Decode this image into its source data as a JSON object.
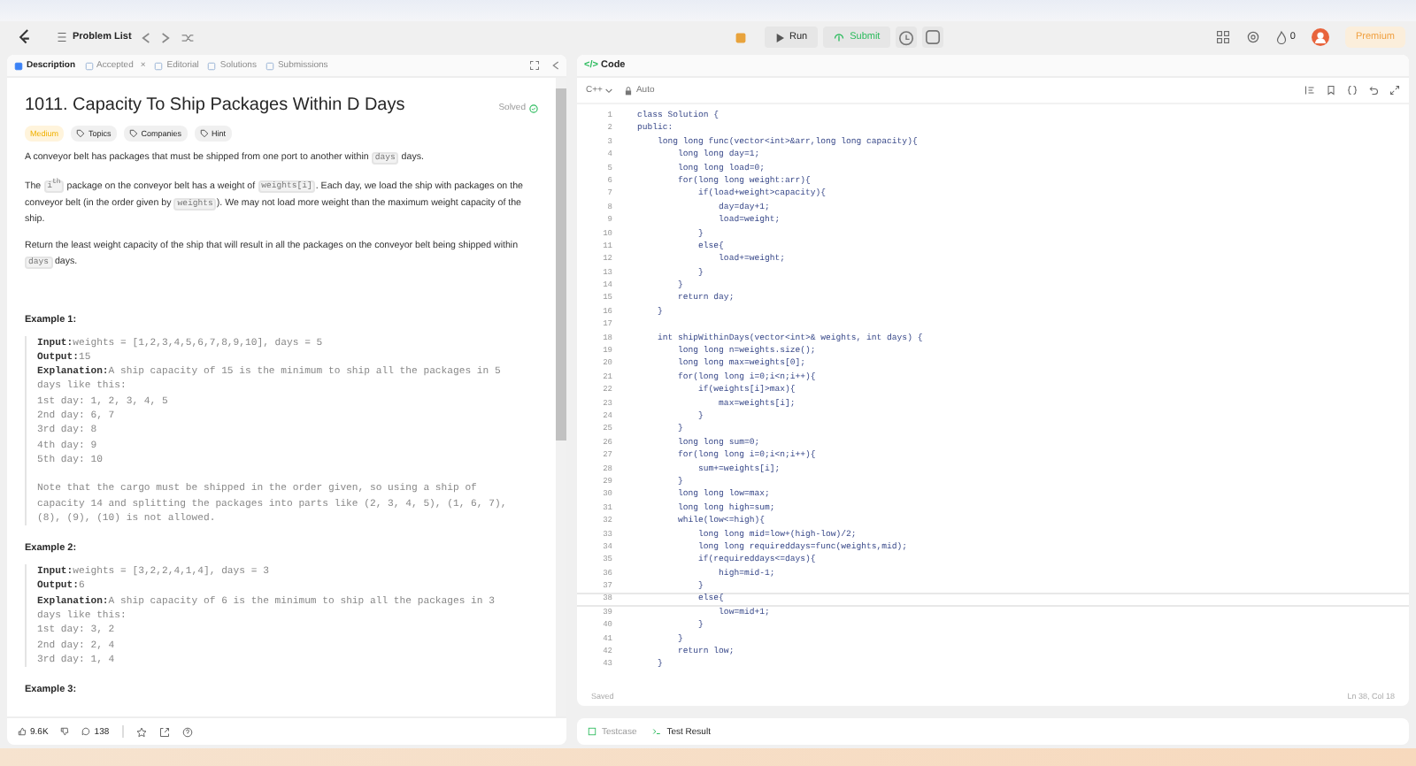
{
  "nav": {
    "problem_list": "Problem List",
    "run": "Run",
    "submit": "Submit",
    "streak": "0",
    "premium": "Premium"
  },
  "left_tabs": [
    {
      "label": "Description",
      "selected": true,
      "closable": false
    },
    {
      "label": "Accepted",
      "selected": false,
      "closable": true,
      "close_glyph": "×"
    },
    {
      "label": "Editorial",
      "selected": false,
      "closable": false
    },
    {
      "label": "Solutions",
      "selected": false,
      "closable": false
    },
    {
      "label": "Submissions",
      "selected": false,
      "closable": false
    }
  ],
  "problem": {
    "title": "1011. Capacity To Ship Packages Within D Days",
    "status": "Solved",
    "difficulty": "Medium",
    "tags": [
      "Topics",
      "Companies",
      "Hint"
    ],
    "paragraphs": [
      [
        {
          "text": "A conveyor belt has packages that must be shipped from one port to another within "
        },
        {
          "text": "days",
          "code": true
        },
        {
          "text": " days."
        }
      ],
      [
        {
          "text": "The "
        },
        {
          "text": "i$^{th}$",
          "code": true
        },
        {
          "text": " package on the conveyor belt has a weight of "
        },
        {
          "text": "weights[i]",
          "code": true
        },
        {
          "text": ". Each day, we load the ship with packages on the conveyor belt (in the order given by "
        },
        {
          "text": "weights",
          "code": true
        },
        {
          "text": "). We may not load more weight than the maximum weight capacity of the ship."
        }
      ],
      [
        {
          "text": "Return the least weight capacity of the ship that will result in all the packages on the conveyor belt being shipped within "
        },
        {
          "text": "days",
          "code": true
        },
        {
          "text": " days."
        }
      ]
    ],
    "examples": [
      {
        "title": "Example 1:",
        "lines": [
          {
            "label": "Input:",
            "text": "weights = [1,2,3,4,5,6,7,8,9,10], days = 5"
          },
          {
            "label": "Output:",
            "text": "15"
          },
          {
            "label": "Explanation:",
            "text": "A ship capacity of 15 is the minimum to ship all the packages in 5"
          },
          {
            "text": "days like this:"
          },
          {
            "text": "1st day: 1, 2, 3, 4, 5"
          },
          {
            "text": "2nd day: 6, 7"
          },
          {
            "text": "3rd day: 8"
          },
          {
            "text": "4th day: 9"
          },
          {
            "text": "5th day: 10"
          },
          {
            "text": "Note that the cargo must be shipped in the order given, so using a ship of",
            "gap": true
          },
          {
            "text": "capacity 14 and splitting the packages into parts like (2, 3, 4, 5), (1, 6, 7),"
          },
          {
            "text": "(8), (9), (10) is not allowed."
          }
        ]
      },
      {
        "title": "Example 2:",
        "lines": [
          {
            "label": "Input:",
            "text": "weights = [3,2,2,4,1,4], days = 3"
          },
          {
            "label": "Output:",
            "text": "6"
          },
          {
            "label": "Explanation:",
            "text": "A ship capacity of 6 is the minimum to ship all the packages in 3"
          },
          {
            "text": "days like this:"
          },
          {
            "text": "1st day: 3, 2"
          },
          {
            "text": "2nd day: 2, 4"
          },
          {
            "text": "3rd day: 1, 4"
          }
        ]
      },
      {
        "title": "Example 3:"
      }
    ],
    "likes": "9.6K",
    "comments": "138"
  },
  "code_panel": {
    "glyph": "</>",
    "title": "Code",
    "language": "C++",
    "mode": "Auto",
    "saved": "Saved",
    "cursor": "Ln 38, Col 18"
  },
  "code_lines": [
    {
      "n": "1",
      "code": "class Solution {"
    },
    {
      "n": "2",
      "code": "public:"
    },
    {
      "n": "3",
      "code": "    long long func(vector<int>&arr,long long capacity){"
    },
    {
      "n": "4",
      "code": "        long long day=1;"
    },
    {
      "n": "5",
      "code": "        long long load=0;"
    },
    {
      "n": "6",
      "code": "        for(long long weight:arr){"
    },
    {
      "n": "7",
      "code": "            if(load+weight>capacity){"
    },
    {
      "n": "8",
      "code": "                day=day+1;"
    },
    {
      "n": "9",
      "code": "                load=weight;"
    },
    {
      "n": "10",
      "code": "            }"
    },
    {
      "n": "11",
      "code": "            else{"
    },
    {
      "n": "12",
      "code": "                load+=weight;"
    },
    {
      "n": "13",
      "code": "            }"
    },
    {
      "n": "14",
      "code": "        }"
    },
    {
      "n": "15",
      "code": "        return day;"
    },
    {
      "n": "16",
      "code": "    }"
    },
    {
      "n": "17"
    },
    {
      "n": "18",
      "code": "    int shipWithinDays(vector<int>& weights, int days) {"
    },
    {
      "n": "19",
      "code": "        long long n=weights.size();"
    },
    {
      "n": "20",
      "code": "        long long max=weights[0];"
    },
    {
      "n": "21",
      "code": "        for(long long i=0;i<n;i++){"
    },
    {
      "n": "22",
      "code": "            if(weights[i]>max){"
    },
    {
      "n": "23",
      "code": "                max=weights[i];"
    },
    {
      "n": "24",
      "code": "            }"
    },
    {
      "n": "25",
      "code": "        }"
    },
    {
      "n": "26",
      "code": "        long long sum=0;"
    },
    {
      "n": "27",
      "code": "        for(long long i=0;i<n;i++){"
    },
    {
      "n": "28",
      "code": "            sum+=weights[i];"
    },
    {
      "n": "29",
      "code": "        }"
    },
    {
      "n": "30",
      "code": "        long long low=max;"
    },
    {
      "n": "31",
      "code": "        long long high=sum;"
    },
    {
      "n": "32",
      "code": "        while(low<=high){"
    },
    {
      "n": "33",
      "code": "            long long mid=low+(high-low)/2;"
    },
    {
      "n": "34",
      "code": "            long long requireddays=func(weights,mid);"
    },
    {
      "n": "35",
      "code": "            if(requireddays<=days){"
    },
    {
      "n": "36",
      "code": "                high=mid-1;"
    },
    {
      "n": "37",
      "code": "            }"
    },
    {
      "n": "38",
      "code": "            else{",
      "current": true
    },
    {
      "n": "39",
      "code": "                low=mid+1;"
    },
    {
      "n": "40",
      "code": "            }"
    },
    {
      "n": "41",
      "code": "        }"
    },
    {
      "n": "42",
      "code": "        return low;"
    },
    {
      "n": "43",
      "code": "    }"
    }
  ],
  "bottom_tabs": [
    {
      "label": "Testcase",
      "selected": false
    },
    {
      "label": "Test Result",
      "selected": true
    }
  ]
}
